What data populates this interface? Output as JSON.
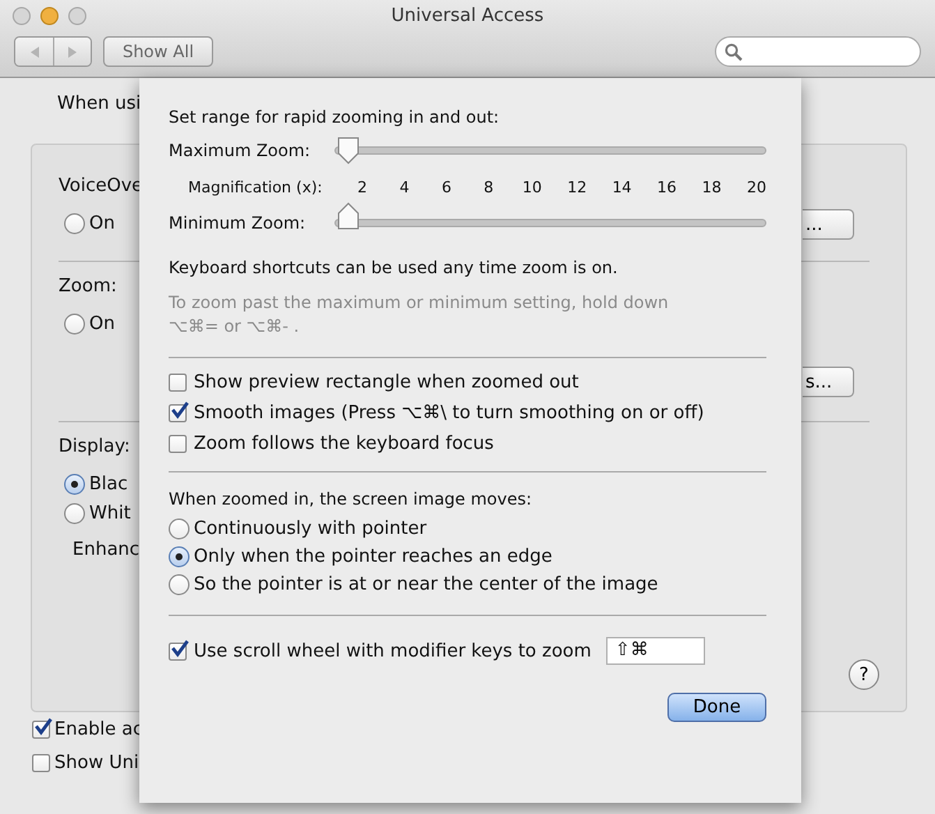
{
  "window": {
    "title": "Universal Access"
  },
  "toolbar": {
    "show_all": "Show All"
  },
  "pane": {
    "intro": "When usi",
    "groups": [
      {
        "label": "VoiceOve",
        "options": [
          {
            "label": "On",
            "selected": false
          }
        ],
        "button": "..."
      },
      {
        "label": "Zoom:",
        "options": [
          {
            "label": "On",
            "selected": false
          }
        ],
        "button": "s..."
      },
      {
        "label": "Display:",
        "options": [
          {
            "label": "Blac",
            "selected": true
          },
          {
            "label": "Whit",
            "selected": false
          }
        ],
        "note": "Enhanc"
      }
    ],
    "help": "?",
    "checkboxes": [
      {
        "label": "Enable ac",
        "checked": true
      },
      {
        "label": "Show Uni",
        "checked": false
      }
    ]
  },
  "sheet": {
    "heading": "Set range for rapid zooming in and out:",
    "max_slider": {
      "label": "Maximum Zoom:",
      "level": 0
    },
    "scale": {
      "label": "Magnification (x):",
      "ticks": [
        "2",
        "4",
        "6",
        "8",
        "10",
        "12",
        "14",
        "16",
        "18",
        "20"
      ]
    },
    "min_slider": {
      "label": "Minimum Zoom:",
      "level": 0
    },
    "shortcut_note": "Keyboard shortcuts can be used any time zoom is on.",
    "hint": "To zoom past the maximum or minimum setting, hold down ⌥⌘= or ⌥⌘- .",
    "options": [
      {
        "label": "Show preview rectangle when zoomed out",
        "checked": false
      },
      {
        "label": "Smooth images (Press ⌥⌘\\ to turn smoothing on or off)",
        "checked": true
      },
      {
        "label": "Zoom follows the keyboard focus",
        "checked": false
      }
    ],
    "movement": {
      "heading": "When zoomed in, the screen image moves:",
      "choices": [
        {
          "label": "Continuously with pointer",
          "selected": false
        },
        {
          "label": "Only when the pointer reaches an edge",
          "selected": true
        },
        {
          "label": "So the pointer is at or near the center of the image",
          "selected": false
        }
      ]
    },
    "scroll": {
      "label": "Use scroll wheel with modifier keys to zoom",
      "checked": true,
      "keys": "⇧⌘"
    },
    "done": "Done"
  }
}
